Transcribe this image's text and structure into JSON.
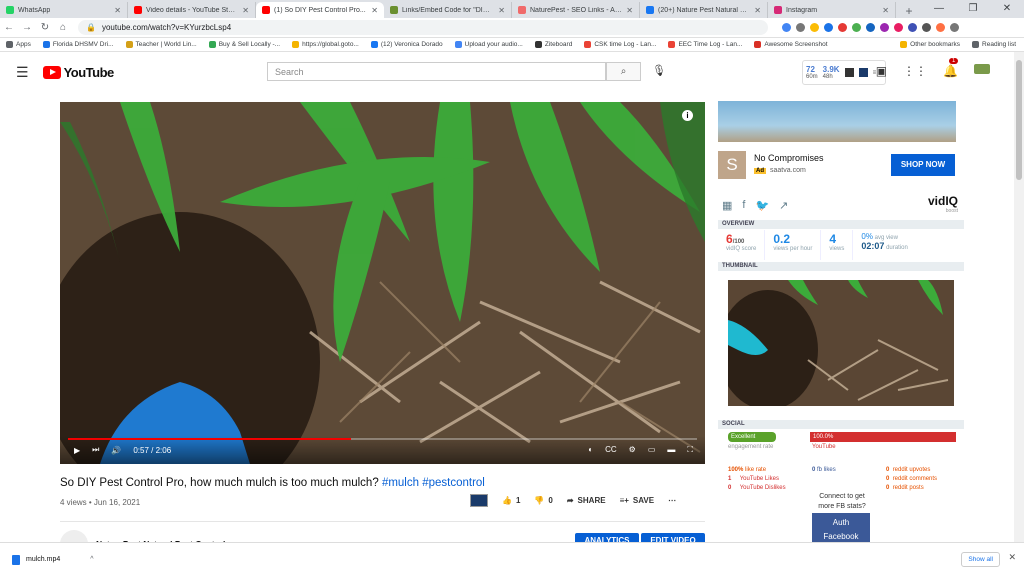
{
  "tabs": [
    {
      "label": "WhatsApp",
      "color": "#25d366"
    },
    {
      "label": "Video details - YouTube Studio",
      "color": "#ff0000"
    },
    {
      "label": "(1) So DIY Pest Control Pro...",
      "color": "#ff0000",
      "active": true
    },
    {
      "label": "Links/Embed Code for \"DIYPC\"...",
      "color": "#6a8f2f"
    },
    {
      "label": "NaturePest - SEO Links - Asana",
      "color": "#f06a6a"
    },
    {
      "label": "(20+) Nature Pest Natural Pest...",
      "color": "#1877f2"
    },
    {
      "label": "Instagram",
      "color": "#d62976"
    }
  ],
  "address": {
    "url": "youtube.com/watch?v=KYurzbcLsp4"
  },
  "bookmarks": [
    {
      "label": "Apps",
      "color": "#5f6368"
    },
    {
      "label": "Florida DHSMV Dri...",
      "color": "#1a73e8"
    },
    {
      "label": "Teacher | World Lin...",
      "color": "#d4a017"
    },
    {
      "label": "Buy & Sell Locally -...",
      "color": "#34a853"
    },
    {
      "label": "https://global.goto...",
      "color": "#f4b400"
    },
    {
      "label": "(12) Veronica Dorado",
      "color": "#1877f2"
    },
    {
      "label": "Upload your audio...",
      "color": "#4285f4"
    },
    {
      "label": "Ziteboard",
      "color": "#333333"
    },
    {
      "label": "CSK time Log - Lan...",
      "color": "#ea4335"
    },
    {
      "label": "EEC Time Log - Lan...",
      "color": "#ea4335"
    },
    {
      "label": "Awesome Screenshot",
      "color": "#d93025"
    },
    {
      "label": "Other bookmarks",
      "color": "#f4b400"
    },
    {
      "label": "Reading list",
      "color": "#5f6368"
    }
  ],
  "youtube": {
    "brand": "YouTube",
    "search_placeholder": "Search",
    "vidstat": {
      "a": "72",
      "a_sub": "60m",
      "b": "3.9K",
      "b_sub": "48h"
    },
    "notif_count": "1"
  },
  "video": {
    "time": "0:57 / 2:06",
    "progress": 0.45,
    "title": "So DIY Pest Control Pro, how much mulch is too much mulch?",
    "hashtags": "#mulch #pestcontrol",
    "meta": "4 views • Jun 16, 2021",
    "likes": "1",
    "dislikes": "0",
    "share": "SHARE",
    "save": "SAVE",
    "channel": "NaturePest Natural Pest Control",
    "analytics": "ANALYTICS",
    "edit": "EDIT VIDEO"
  },
  "ad": {
    "letter": "S",
    "title": "No Compromises",
    "badge": "Ad",
    "domain": "saatva.com",
    "cta": "SHOP NOW"
  },
  "vidiq": {
    "logo": "vidIQ",
    "logo_sub": "boost",
    "overview_label": "OVERVIEW",
    "score": "6",
    "score_suffix": "/100",
    "score_label": "vidIQ score",
    "views_per_hour": "0.2",
    "views_per_hour_label": "views per hour",
    "views": "4",
    "views_label": "views",
    "percent": "0%",
    "percent_label": "avg view",
    "duration": "02:07",
    "duration_label": "duration",
    "thumbnail_label": "THUMBNAIL",
    "social_label": "SOCIAL",
    "engagement_badge": "Excellent",
    "engagement_label": "engagement rate",
    "youtube_pct": "100.0%",
    "youtube_label": "YouTube",
    "like_rate": "100%",
    "like_rate_label": "like rate",
    "yt_likes": "1",
    "yt_likes_label": "YouTube Likes",
    "yt_dislikes": "0",
    "yt_dislikes_label": "YouTube Dislikes",
    "fb_likes": "0",
    "fb_likes_label": "fb likes",
    "reddit_upvotes": "0",
    "reddit_upvotes_label": "reddit upvotes",
    "reddit_comments": "0",
    "reddit_comments_label": "reddit comments",
    "reddit_posts": "0",
    "reddit_posts_label": "reddit posts",
    "fb_connect_1": "Connect to get",
    "fb_connect_2": "more FB stats?",
    "auth_1": "Auth",
    "auth_2": "Facebook"
  },
  "download": {
    "file": "mulch.mp4",
    "show_all": "Show all"
  }
}
